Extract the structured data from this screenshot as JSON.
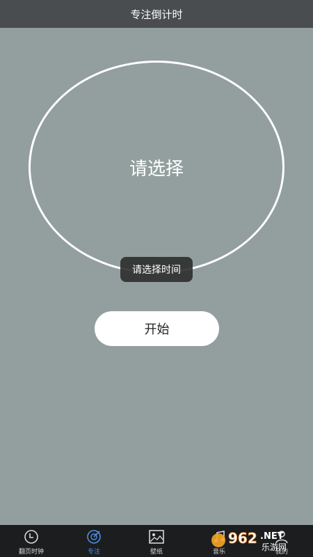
{
  "header": {
    "title": "专注倒计时"
  },
  "timer": {
    "ring_label": "请选择",
    "toast": "请选择时间",
    "start_label": "开始"
  },
  "tabbar": {
    "active_color": "#4a90e2",
    "items": [
      {
        "label": "翻页时钟",
        "icon": "clock-icon"
      },
      {
        "label": "专注",
        "icon": "focus-target-icon"
      },
      {
        "label": "壁纸",
        "icon": "image-icon"
      },
      {
        "label": "音乐",
        "icon": "music-icon"
      },
      {
        "label": "我的",
        "icon": "profile-icon"
      }
    ]
  },
  "watermark": {
    "text": "962.NET",
    "subtext": "乐游网"
  }
}
